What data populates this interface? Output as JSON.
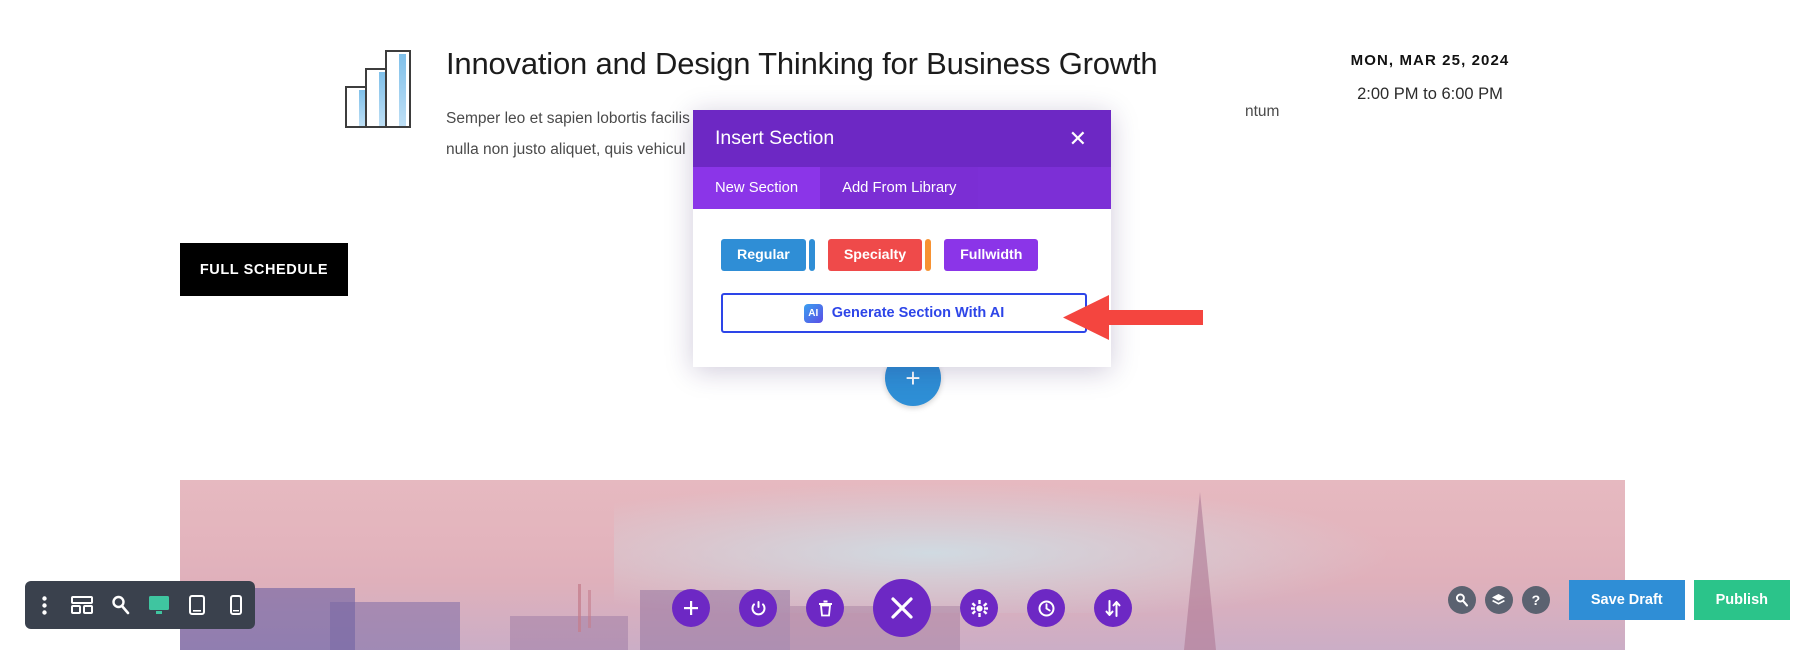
{
  "page": {
    "event": {
      "title": "Innovation and Design Thinking for Business Growth",
      "body_line1": "Semper leo et sapien lobortis facilis",
      "body_line2": "nulla non justo aliquet, quis vehicul",
      "body_tail": "ntum",
      "date": "MON, MAR 25, 2024",
      "time": "2:00 PM to 6:00 PM",
      "schedule_button": "FULL SCHEDULE",
      "chart_icon": "bar-chart-icon"
    },
    "add_section_circle": {
      "icon": "plus-icon",
      "glyph": "+"
    }
  },
  "modal": {
    "title": "Insert Section",
    "close_icon": "close-icon",
    "close_glyph": "✕",
    "tabs": [
      {
        "label": "New Section",
        "active": true
      },
      {
        "label": "Add From Library",
        "active": false
      }
    ],
    "section_types": [
      {
        "label": "Regular",
        "color": "#2f8ed6"
      },
      {
        "label": "Specialty",
        "color": "#ef4a4a"
      },
      {
        "label": "Fullwidth",
        "color": "#8b35e8"
      }
    ],
    "ai_button": {
      "label": "Generate Section With AI",
      "badge_text": "AI",
      "badge_icon": "ai-sparkle-icon",
      "border_color": "#2d45e8"
    },
    "header_color": "#6d28c4",
    "tabs_color": "#7c2fd6"
  },
  "annotation": {
    "arrow": "red-arrow-pointing-left",
    "color": "#f4453f"
  },
  "toolbar": {
    "left_items": [
      {
        "name": "more-options-icon",
        "label": "More Options"
      },
      {
        "name": "wireframe-icon",
        "label": "Wireframe View"
      },
      {
        "name": "search-icon",
        "label": "Zoom Out"
      },
      {
        "name": "desktop-icon",
        "label": "Desktop View",
        "active": true
      },
      {
        "name": "tablet-icon",
        "label": "Tablet View"
      },
      {
        "name": "phone-icon",
        "label": "Phone View"
      }
    ],
    "center_items": [
      {
        "name": "add-icon",
        "label": "Add Section",
        "glyph": "+"
      },
      {
        "name": "power-icon",
        "label": "Disable Builder"
      },
      {
        "name": "trash-icon",
        "label": "Clear Layout"
      },
      {
        "name": "close-icon",
        "label": "Close Builder",
        "glyph": "✕",
        "large": true
      },
      {
        "name": "gear-icon",
        "label": "Page Settings"
      },
      {
        "name": "history-icon",
        "label": "Editing History"
      },
      {
        "name": "sort-icon",
        "label": "Sort / Resize"
      }
    ],
    "right_items": [
      {
        "name": "search-icon",
        "label": "Search"
      },
      {
        "name": "layers-icon",
        "label": "Layers"
      },
      {
        "name": "help-icon",
        "label": "Help",
        "glyph": "?"
      }
    ],
    "save_draft_label": "Save Draft",
    "publish_label": "Publish",
    "save_draft_color": "#2f8ed6",
    "publish_color": "#2bc48a",
    "bar_color": "#3a414d"
  }
}
